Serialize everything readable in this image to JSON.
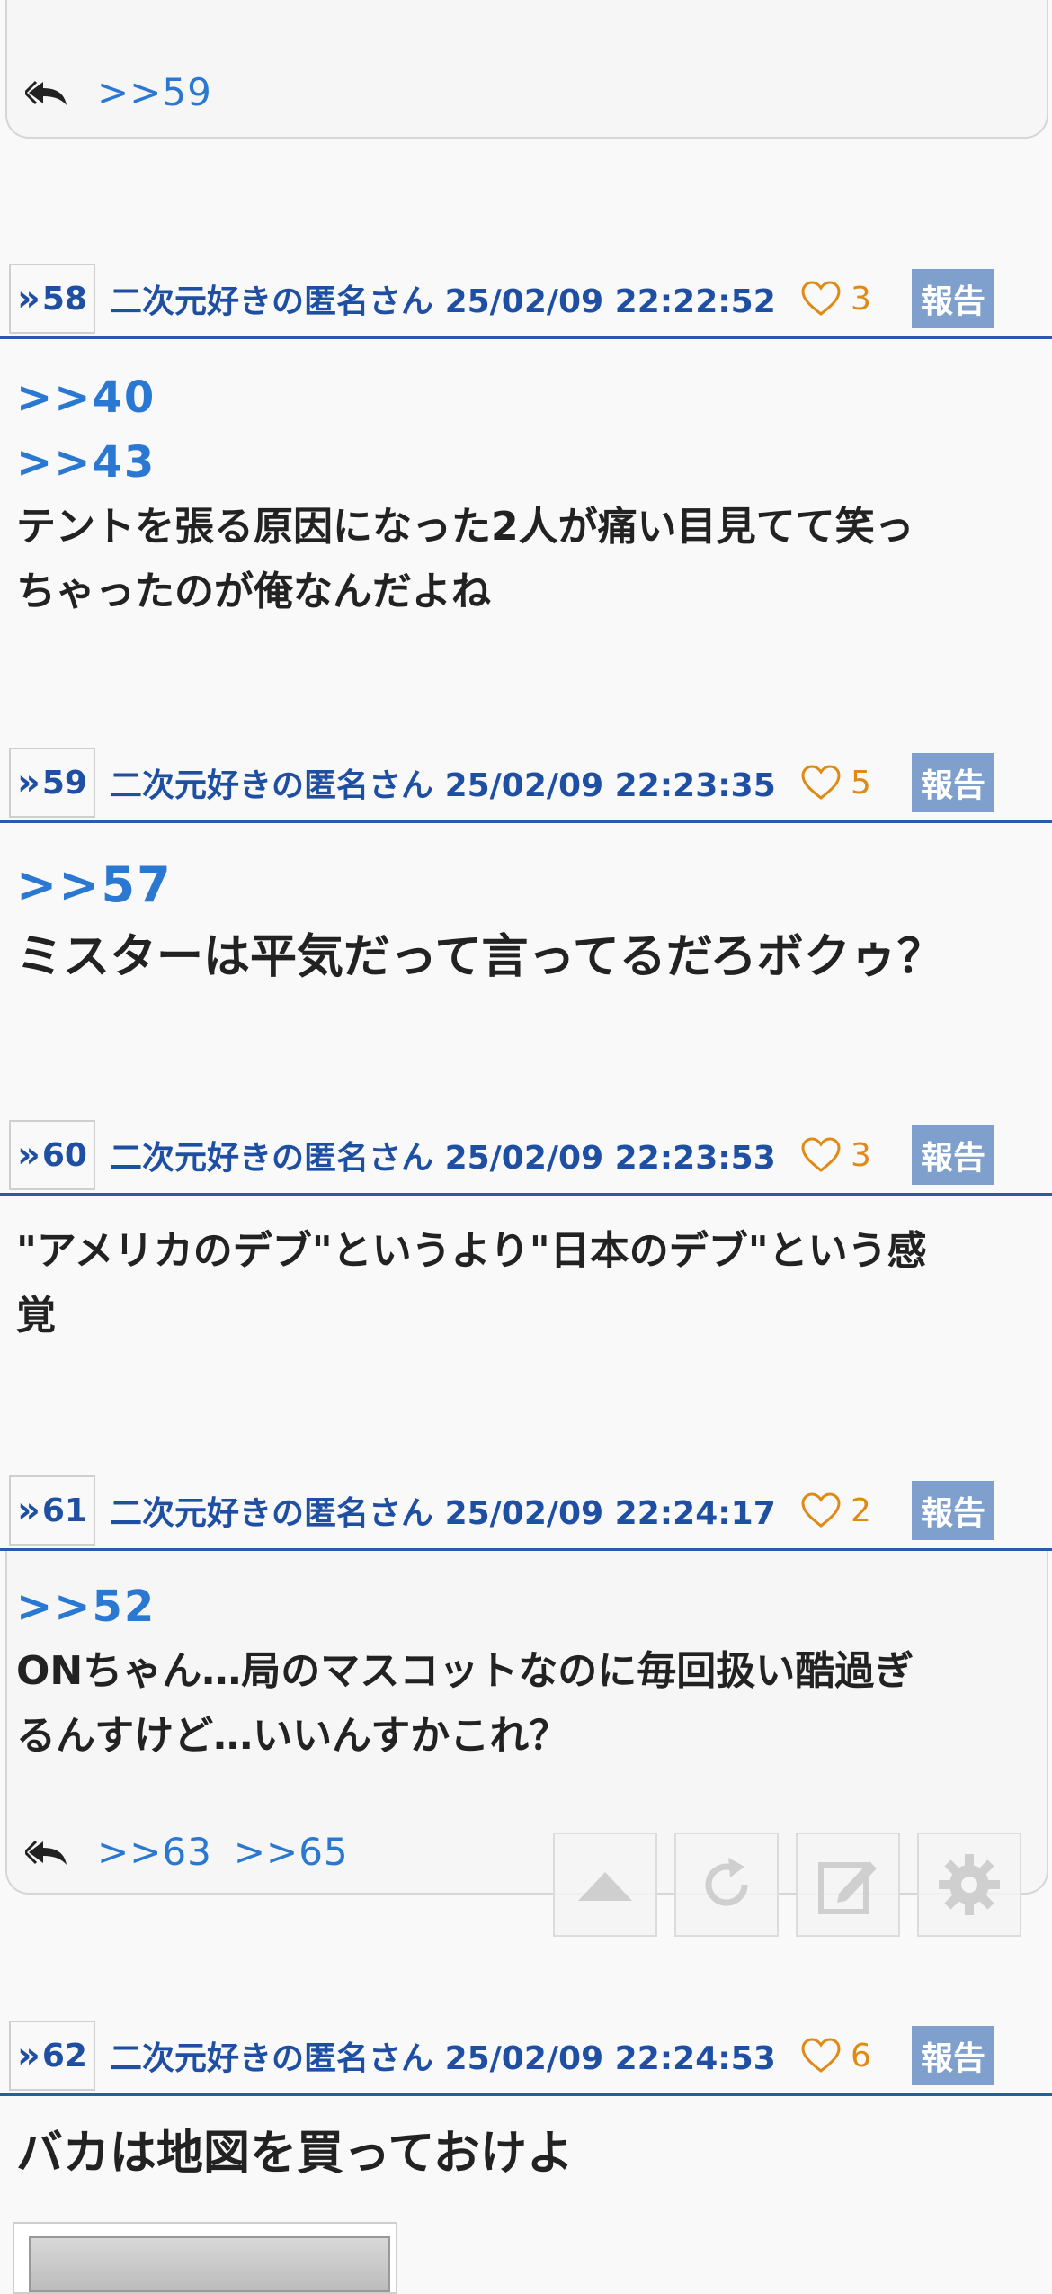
{
  "top_card": {
    "replies": [
      ">>59"
    ]
  },
  "posts": [
    {
      "num": "58",
      "poster": "二次元好きの匿名さん",
      "datetime": "25/02/09 22:22:52",
      "likes": "3",
      "report_label": "報告",
      "anchors": [
        ">>40",
        ">>43"
      ],
      "lines": [
        "テントを張る原因になった2人が痛い目見てて笑っ",
        "ちゃったのが俺なんだよね"
      ]
    },
    {
      "num": "59",
      "poster": "二次元好きの匿名さん",
      "datetime": "25/02/09 22:23:35",
      "likes": "5",
      "report_label": "報告",
      "anchors": [
        ">>57"
      ],
      "lines": [
        "ミスターは平気だって言ってるだろボクゥ？"
      ]
    },
    {
      "num": "60",
      "poster": "二次元好きの匿名さん",
      "datetime": "25/02/09 22:23:53",
      "likes": "3",
      "report_label": "報告",
      "anchors": [],
      "lines": [
        "\"アメリカのデブ\"というより\"日本のデブ\"という感",
        "覚"
      ]
    },
    {
      "num": "61",
      "poster": "二次元好きの匿名さん",
      "datetime": "25/02/09 22:24:17",
      "likes": "2",
      "report_label": "報告",
      "anchors": [
        ">>52"
      ],
      "lines": [
        "ONちゃん…局のマスコットなのに毎回扱い酷過ぎ",
        "るんすけど…いいんすかこれ？"
      ],
      "replies": [
        ">>63",
        ">>65"
      ]
    },
    {
      "num": "62",
      "poster": "二次元好きの匿名さん",
      "datetime": "25/02/09 22:24:53",
      "likes": "6",
      "report_label": "報告",
      "anchors": [],
      "lines": [
        "バカは地図を買っておけよ"
      ]
    }
  ],
  "toolbar": {
    "icons": [
      "arrow-up-icon",
      "refresh-icon",
      "edit-icon",
      "gear-icon"
    ]
  }
}
